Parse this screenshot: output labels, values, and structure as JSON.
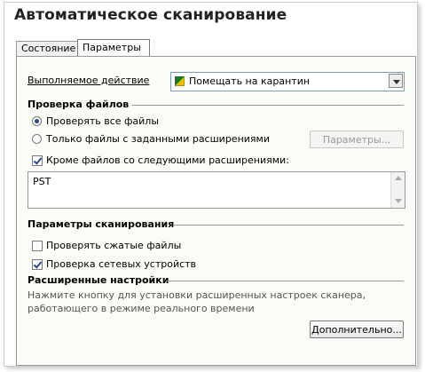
{
  "window": {
    "title": "Автоматическое сканирование"
  },
  "tabs": [
    {
      "label": "Состояние",
      "active": false
    },
    {
      "label": "Параметры",
      "active": true
    }
  ],
  "action": {
    "label": "Выполняемое действие",
    "label_access_key": "В",
    "select_value": "Помещать на карантин",
    "select_icon": "quarantine-flag-icon"
  },
  "file_check": {
    "heading": "Проверка файлов",
    "radio_all": {
      "label": "Проверять все файлы",
      "checked": true
    },
    "radio_ext": {
      "label": "Только файлы с заданными расширениями",
      "checked": false
    },
    "params_button": "Параметры...",
    "exclude_checkbox": {
      "label": "Кроме файлов со следующими расширениями:",
      "checked": true
    },
    "exclude_value": "PST"
  },
  "scan_params": {
    "heading": "Параметры сканирования",
    "compressed": {
      "label": "Проверять сжатые файлы",
      "checked": false
    },
    "network": {
      "label": "Проверка сетевых устройств",
      "checked": true
    }
  },
  "advanced": {
    "heading": "Расширенные настройки",
    "description": "Нажмите кнопку для установки расширенных настроек сканера, работающего в режиме реального времени",
    "button": "Дополнительно..."
  },
  "colors": {
    "accent": "#2a4a8a",
    "border": "#9a9a9a",
    "panel_bg": "#fbfbf7"
  }
}
